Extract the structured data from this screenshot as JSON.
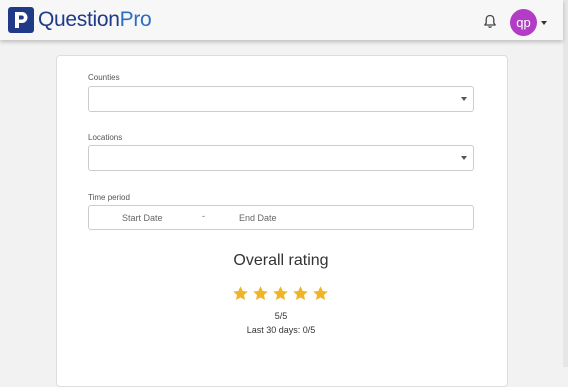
{
  "header": {
    "brand_q": "Question",
    "brand_p": "Pro",
    "avatar_initials": "qp",
    "icons": [
      "questionpro-logo-icon",
      "bell-icon",
      "chevron-down-icon"
    ]
  },
  "filters": {
    "counties_label": "Counties",
    "counties_value": "",
    "locations_label": "Locations",
    "locations_value": "",
    "time_period_label": "Time period",
    "start_date_placeholder": "Start Date",
    "date_separator": "-",
    "end_date_placeholder": "End Date"
  },
  "rating": {
    "title": "Overall rating",
    "stars_filled": 5,
    "stars_total": 5,
    "value_text": "5/5",
    "last30_text": "Last 30 days: 0/5"
  },
  "colors": {
    "brand_dark": "#1f3b88",
    "brand_light": "#2d6dc4",
    "avatar": "#b23cc6",
    "star": "#f0b429"
  }
}
